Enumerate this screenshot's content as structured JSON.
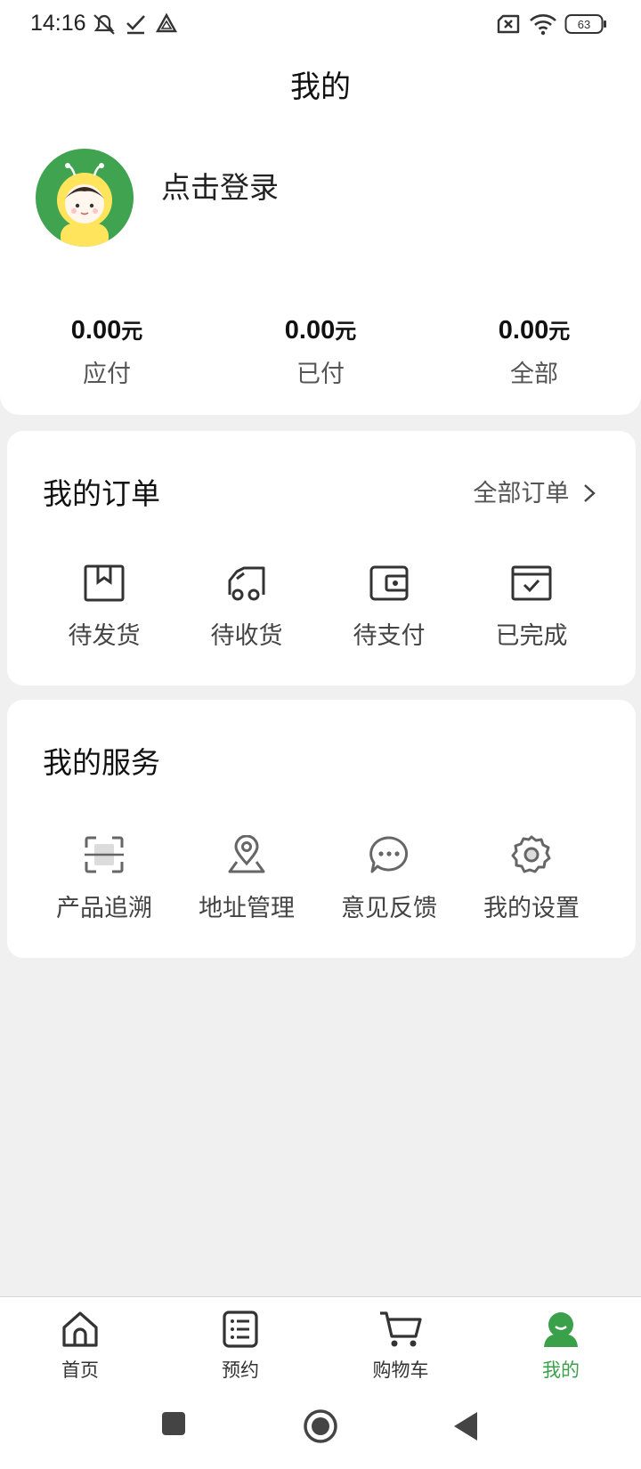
{
  "status_bar": {
    "time": "14:16",
    "battery": "63",
    "icons": [
      "mute-icon",
      "check-icon",
      "drive-icon",
      "sim-off-icon",
      "wifi-icon",
      "battery-icon"
    ]
  },
  "header": {
    "title": "我的"
  },
  "profile": {
    "login_text": "点击登录",
    "avatar_icon": "avatar-icon"
  },
  "stats": [
    {
      "value": "0.00",
      "unit": "元",
      "label": "应付"
    },
    {
      "value": "0.00",
      "unit": "元",
      "label": "已付"
    },
    {
      "value": "0.00",
      "unit": "元",
      "label": "全部"
    }
  ],
  "orders": {
    "title": "我的订单",
    "all_link": "全部订单",
    "items": [
      {
        "label": "待发货",
        "icon": "package-icon"
      },
      {
        "label": "待收货",
        "icon": "truck-icon"
      },
      {
        "label": "待支付",
        "icon": "wallet-icon"
      },
      {
        "label": "已完成",
        "icon": "completed-box-icon"
      }
    ]
  },
  "services": {
    "title": "我的服务",
    "items": [
      {
        "label": "产品追溯",
        "icon": "scan-icon"
      },
      {
        "label": "地址管理",
        "icon": "location-icon"
      },
      {
        "label": "意见反馈",
        "icon": "chat-icon"
      },
      {
        "label": "我的设置",
        "icon": "gear-icon"
      }
    ]
  },
  "bottom_nav": {
    "items": [
      {
        "label": "首页",
        "icon": "home-icon"
      },
      {
        "label": "预约",
        "icon": "list-icon"
      },
      {
        "label": "购物车",
        "icon": "cart-icon"
      },
      {
        "label": "我的",
        "icon": "user-icon",
        "active": true
      }
    ]
  },
  "colors": {
    "accent": "#3aa14a",
    "background": "#f0f0f0",
    "card": "#ffffff"
  }
}
